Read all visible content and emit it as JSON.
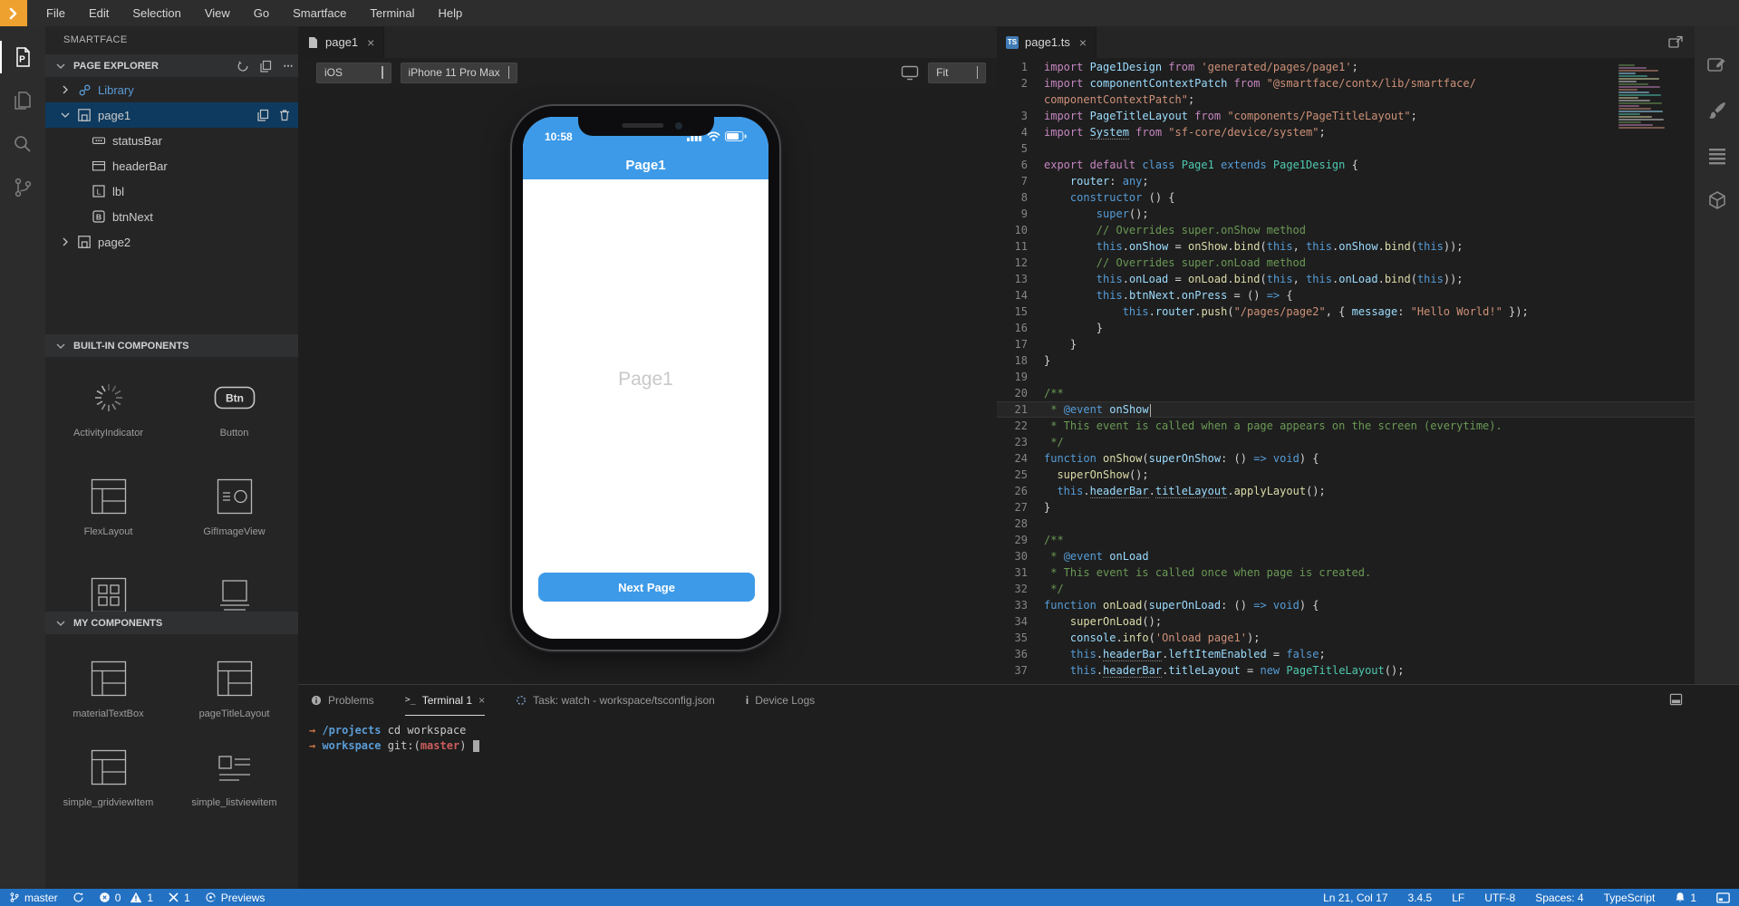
{
  "menu": {
    "items": [
      "File",
      "Edit",
      "Selection",
      "View",
      "Go",
      "Smartface",
      "Terminal",
      "Help"
    ]
  },
  "colors": {
    "phone_accent": "#3D9AE8",
    "status_bar": "#2371C2",
    "logo_orange": "#EFA12F"
  },
  "activity_bar": {
    "left": [
      {
        "id": "page-explorer-icon",
        "active": true
      },
      {
        "id": "files-icon",
        "active": false
      },
      {
        "id": "search-icon",
        "active": false
      },
      {
        "id": "source-control-icon",
        "active": false
      }
    ],
    "right": [
      {
        "id": "design-editor-icon"
      },
      {
        "id": "theme-brush-icon"
      },
      {
        "id": "outline-list-icon"
      },
      {
        "id": "assets-cube-icon"
      }
    ]
  },
  "sidebar": {
    "title": "SMARTFACE",
    "page_explorer": {
      "label": "PAGE EXPLORER",
      "actions": [
        "refresh-icon",
        "duplicate-icon",
        "more-actions-icon"
      ],
      "tree": [
        {
          "label": "Library",
          "icon": "link",
          "chevron": "right",
          "blue": true
        },
        {
          "label": "page1",
          "icon": "page",
          "chevron": "down",
          "selected": true,
          "actions": [
            "duplicate-icon",
            "delete-icon"
          ]
        },
        {
          "label": "statusBar",
          "icon": "statusbar",
          "child": true
        },
        {
          "label": "headerBar",
          "icon": "headerbar",
          "child": true
        },
        {
          "label": "lbl",
          "icon": "label",
          "child": true
        },
        {
          "label": "btnNext",
          "icon": "button-b",
          "child": true
        },
        {
          "label": "page2",
          "icon": "page",
          "chevron": "right"
        }
      ]
    },
    "built_in_components": {
      "label": "BUILT-IN COMPONENTS",
      "items": [
        {
          "label": "ActivityIndicator",
          "icon": "activity-indicator"
        },
        {
          "label": "Button",
          "icon": "btn-box"
        },
        {
          "label": "FlexLayout",
          "icon": "flex-layout"
        },
        {
          "label": "GifImageView",
          "icon": "gif-image"
        },
        {
          "label": "",
          "icon": "grid-view"
        },
        {
          "label": "",
          "icon": "image-view"
        }
      ]
    },
    "my_components": {
      "label": "MY COMPONENTS",
      "items": [
        {
          "label": "materialTextBox",
          "icon": "flex-layout"
        },
        {
          "label": "pageTitleLayout",
          "icon": "flex-layout"
        },
        {
          "label": "simple_gridviewItem",
          "icon": "flex-layout"
        },
        {
          "label": "simple_listviewitem",
          "icon": "list-item"
        }
      ]
    }
  },
  "preview": {
    "tab": "page1",
    "os": "iOS",
    "device": "iPhone 11 Pro Max",
    "zoom": "Fit",
    "phone": {
      "time": "10:58",
      "header_title": "Page1",
      "body_label": "Page1",
      "button_label": "Next Page",
      "accent_color": "#3D9AE8"
    }
  },
  "editor": {
    "tab": "page1.ts",
    "lines": [
      {
        "n": "1",
        "tk": [
          [
            "kw",
            "import "
          ],
          [
            "v",
            "Page1Design"
          ],
          [
            "kw",
            " from "
          ],
          [
            "s",
            "'generated/pages/page1'"
          ],
          [
            "p",
            ";"
          ]
        ]
      },
      {
        "n": "2",
        "tk": [
          [
            "kw",
            "import "
          ],
          [
            "v",
            "componentContextPatch"
          ],
          [
            "kw",
            " from "
          ],
          [
            "s",
            "\"@smartface/contx/lib/smartface/"
          ]
        ]
      },
      {
        "n": "",
        "tk": [
          [
            "s",
            "componentContextPatch\""
          ],
          [
            "p",
            ";"
          ]
        ]
      },
      {
        "n": "3",
        "tk": [
          [
            "kw",
            "import "
          ],
          [
            "v",
            "PageTitleLayout"
          ],
          [
            "kw",
            " from "
          ],
          [
            "s",
            "\"components/PageTitleLayout\""
          ],
          [
            "p",
            ";"
          ]
        ]
      },
      {
        "n": "4",
        "tk": [
          [
            "kw",
            "import "
          ],
          [
            "vu",
            "System"
          ],
          [
            "kw",
            " from "
          ],
          [
            "s",
            "\"sf-core/device/system\""
          ],
          [
            "p",
            ";"
          ]
        ]
      },
      {
        "n": "5",
        "tk": []
      },
      {
        "n": "6",
        "tk": [
          [
            "kw",
            "export "
          ],
          [
            "kw",
            "default "
          ],
          [
            "st",
            "class "
          ],
          [
            "c",
            "Page1 "
          ],
          [
            "st",
            "extends "
          ],
          [
            "c",
            "Page1Design "
          ],
          [
            "p",
            "{"
          ]
        ]
      },
      {
        "n": "7",
        "tk": [
          [
            "p",
            "    "
          ],
          [
            "v",
            "router"
          ],
          [
            "p",
            ": "
          ],
          [
            "st",
            "any"
          ],
          [
            "p",
            ";"
          ]
        ]
      },
      {
        "n": "8",
        "tk": [
          [
            "p",
            "    "
          ],
          [
            "st",
            "constructor"
          ],
          [
            "p",
            " () {"
          ]
        ]
      },
      {
        "n": "9",
        "tk": [
          [
            "p",
            "        "
          ],
          [
            "st",
            "super"
          ],
          [
            "p",
            "();"
          ]
        ]
      },
      {
        "n": "10",
        "tk": [
          [
            "p",
            "        "
          ],
          [
            "cm",
            "// Overrides super.onShow method"
          ]
        ]
      },
      {
        "n": "11",
        "tk": [
          [
            "p",
            "        "
          ],
          [
            "st",
            "this"
          ],
          [
            "p",
            "."
          ],
          [
            "v",
            "onShow"
          ],
          [
            "p",
            " = "
          ],
          [
            "f",
            "onShow"
          ],
          [
            "p",
            "."
          ],
          [
            "f",
            "bind"
          ],
          [
            "p",
            "("
          ],
          [
            "st",
            "this"
          ],
          [
            "p",
            ", "
          ],
          [
            "st",
            "this"
          ],
          [
            "p",
            "."
          ],
          [
            "v",
            "onShow"
          ],
          [
            "p",
            "."
          ],
          [
            "f",
            "bind"
          ],
          [
            "p",
            "("
          ],
          [
            "st",
            "this"
          ],
          [
            "p",
            "));"
          ]
        ]
      },
      {
        "n": "12",
        "tk": [
          [
            "p",
            "        "
          ],
          [
            "cm",
            "// Overrides super.onLoad method"
          ]
        ]
      },
      {
        "n": "13",
        "tk": [
          [
            "p",
            "        "
          ],
          [
            "st",
            "this"
          ],
          [
            "p",
            "."
          ],
          [
            "v",
            "onLoad"
          ],
          [
            "p",
            " = "
          ],
          [
            "f",
            "onLoad"
          ],
          [
            "p",
            "."
          ],
          [
            "f",
            "bind"
          ],
          [
            "p",
            "("
          ],
          [
            "st",
            "this"
          ],
          [
            "p",
            ", "
          ],
          [
            "st",
            "this"
          ],
          [
            "p",
            "."
          ],
          [
            "v",
            "onLoad"
          ],
          [
            "p",
            "."
          ],
          [
            "f",
            "bind"
          ],
          [
            "p",
            "("
          ],
          [
            "st",
            "this"
          ],
          [
            "p",
            "));"
          ]
        ]
      },
      {
        "n": "14",
        "tk": [
          [
            "p",
            "        "
          ],
          [
            "st",
            "this"
          ],
          [
            "p",
            "."
          ],
          [
            "v",
            "btnNext"
          ],
          [
            "p",
            "."
          ],
          [
            "v",
            "onPress"
          ],
          [
            "p",
            " = () "
          ],
          [
            "st",
            "=>"
          ],
          [
            "p",
            " {"
          ]
        ]
      },
      {
        "n": "15",
        "tk": [
          [
            "p",
            "            "
          ],
          [
            "st",
            "this"
          ],
          [
            "p",
            "."
          ],
          [
            "v",
            "router"
          ],
          [
            "p",
            "."
          ],
          [
            "f",
            "push"
          ],
          [
            "p",
            "("
          ],
          [
            "s",
            "\"/pages/page2\""
          ],
          [
            "p",
            ", { "
          ],
          [
            "v",
            "message"
          ],
          [
            "p",
            ": "
          ],
          [
            "s",
            "\"Hello World!\""
          ],
          [
            "p",
            " });"
          ]
        ]
      },
      {
        "n": "16",
        "tk": [
          [
            "p",
            "        }"
          ]
        ]
      },
      {
        "n": "17",
        "tk": [
          [
            "p",
            "    }"
          ]
        ]
      },
      {
        "n": "18",
        "tk": [
          [
            "p",
            "}"
          ]
        ]
      },
      {
        "n": "19",
        "tk": []
      },
      {
        "n": "20",
        "tk": [
          [
            "cm",
            "/**"
          ]
        ]
      },
      {
        "n": "21",
        "active": true,
        "tk": [
          [
            "cm",
            " * "
          ],
          [
            "st",
            "@event"
          ],
          [
            "cm",
            " "
          ],
          [
            "v",
            "onShow"
          ]
        ]
      },
      {
        "n": "22",
        "tk": [
          [
            "cm",
            " * This event is called when a page appears on the screen (everytime)."
          ]
        ]
      },
      {
        "n": "23",
        "tk": [
          [
            "cm",
            " */"
          ]
        ]
      },
      {
        "n": "24",
        "tk": [
          [
            "st",
            "function "
          ],
          [
            "f",
            "onShow"
          ],
          [
            "p",
            "("
          ],
          [
            "v",
            "superOnShow"
          ],
          [
            "p",
            ": () "
          ],
          [
            "st",
            "=>"
          ],
          [
            "p",
            " "
          ],
          [
            "st",
            "void"
          ],
          [
            "p",
            ") {"
          ]
        ]
      },
      {
        "n": "25",
        "tk": [
          [
            "p",
            "  "
          ],
          [
            "f",
            "superOnShow"
          ],
          [
            "p",
            "();"
          ]
        ]
      },
      {
        "n": "26",
        "tk": [
          [
            "p",
            "  "
          ],
          [
            "st",
            "this"
          ],
          [
            "p",
            "."
          ],
          [
            "vu",
            "headerBar"
          ],
          [
            "p",
            "."
          ],
          [
            "vu",
            "titleLayout"
          ],
          [
            "p",
            "."
          ],
          [
            "f",
            "applyLayout"
          ],
          [
            "p",
            "();"
          ]
        ]
      },
      {
        "n": "27",
        "tk": [
          [
            "p",
            "}"
          ]
        ]
      },
      {
        "n": "28",
        "tk": []
      },
      {
        "n": "29",
        "tk": [
          [
            "cm",
            "/**"
          ]
        ]
      },
      {
        "n": "30",
        "tk": [
          [
            "cm",
            " * "
          ],
          [
            "st",
            "@event"
          ],
          [
            "cm",
            " "
          ],
          [
            "v",
            "onLoad"
          ]
        ]
      },
      {
        "n": "31",
        "tk": [
          [
            "cm",
            " * This event is called once when page is created."
          ]
        ]
      },
      {
        "n": "32",
        "tk": [
          [
            "cm",
            " */"
          ]
        ]
      },
      {
        "n": "33",
        "tk": [
          [
            "st",
            "function "
          ],
          [
            "f",
            "onLoad"
          ],
          [
            "p",
            "("
          ],
          [
            "v",
            "superOnLoad"
          ],
          [
            "p",
            ": () "
          ],
          [
            "st",
            "=>"
          ],
          [
            "p",
            " "
          ],
          [
            "st",
            "void"
          ],
          [
            "p",
            ") {"
          ]
        ]
      },
      {
        "n": "34",
        "tk": [
          [
            "p",
            "    "
          ],
          [
            "f",
            "superOnLoad"
          ],
          [
            "p",
            "();"
          ]
        ]
      },
      {
        "n": "35",
        "tk": [
          [
            "p",
            "    "
          ],
          [
            "v",
            "console"
          ],
          [
            "p",
            "."
          ],
          [
            "f",
            "info"
          ],
          [
            "p",
            "("
          ],
          [
            "s",
            "'Onload page1'"
          ],
          [
            "p",
            ");"
          ]
        ]
      },
      {
        "n": "36",
        "tk": [
          [
            "p",
            "    "
          ],
          [
            "st",
            "this"
          ],
          [
            "p",
            "."
          ],
          [
            "vu",
            "headerBar"
          ],
          [
            "p",
            "."
          ],
          [
            "v",
            "leftItemEnabled"
          ],
          [
            "p",
            " = "
          ],
          [
            "st",
            "false"
          ],
          [
            "p",
            ";"
          ]
        ]
      },
      {
        "n": "37",
        "tk": [
          [
            "p",
            "    "
          ],
          [
            "st",
            "this"
          ],
          [
            "p",
            "."
          ],
          [
            "vu",
            "headerBar"
          ],
          [
            "p",
            "."
          ],
          [
            "v",
            "titleLayout"
          ],
          [
            "p",
            " = "
          ],
          [
            "st",
            "new "
          ],
          [
            "c",
            "PageTitleLayout"
          ],
          [
            "p",
            "();"
          ]
        ]
      }
    ]
  },
  "panel": {
    "tabs": [
      {
        "label": "Problems",
        "icon": "problems-icon"
      },
      {
        "label": "Terminal 1",
        "icon": "terminal-icon",
        "active": true,
        "closable": true
      },
      {
        "label": "Task: watch - workspace/tsconfig.json",
        "icon": "task-spinner-icon"
      },
      {
        "label": "Device Logs",
        "icon": "device-logs-icon"
      }
    ],
    "terminal_lines": [
      [
        [
          "arrow",
          "→ "
        ],
        [
          "dir",
          "/projects "
        ],
        [
          "plain",
          "cd workspace"
        ]
      ],
      [
        [
          "arrow",
          "→ "
        ],
        [
          "dir",
          "workspace "
        ],
        [
          "plain",
          "git:("
        ],
        [
          "branch",
          "master"
        ],
        [
          "plain",
          ") "
        ]
      ]
    ]
  },
  "status_bar": {
    "branch": "master",
    "errors": "0",
    "warnings": "1",
    "tools": "1",
    "previews": "Previews",
    "cursor": "Ln 21, Col 17",
    "version": "3.4.5",
    "eol": "LF",
    "encoding": "UTF-8",
    "indent": "Spaces: 4",
    "language": "TypeScript",
    "notifications": "1"
  }
}
